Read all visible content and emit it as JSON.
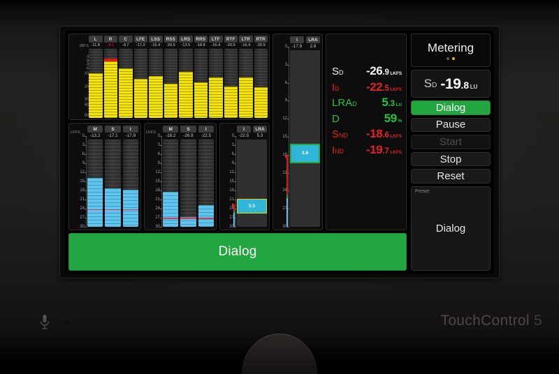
{
  "device": {
    "brand_name": "TouchControl",
    "brand_number": "5",
    "mic_icon": "microphone-icon"
  },
  "ppm": {
    "unit_label": "dBFS",
    "scale_ticks": [
      "3",
      "0",
      "3",
      "6",
      "10",
      "20",
      "30",
      "40",
      "60"
    ],
    "channels": [
      {
        "tag": "L",
        "value": "-11.8",
        "over": false,
        "level_pct": 64,
        "peak": false
      },
      {
        "tag": "R",
        "value": "-4.1",
        "over": true,
        "level_pct": 82,
        "peak": true
      },
      {
        "tag": "C",
        "value": "-9.7",
        "over": false,
        "level_pct": 72,
        "peak": false
      },
      {
        "tag": "LFE",
        "value": "-17.2",
        "over": false,
        "level_pct": 56,
        "peak": false
      },
      {
        "tag": "LSS",
        "value": "-15.4",
        "over": false,
        "level_pct": 60,
        "peak": false
      },
      {
        "tag": "RSS",
        "value": "-20.5",
        "over": false,
        "level_pct": 49,
        "peak": false
      },
      {
        "tag": "LRS",
        "value": "-13.5",
        "over": false,
        "level_pct": 66,
        "peak": false
      },
      {
        "tag": "RRS",
        "value": "-18.8",
        "over": false,
        "level_pct": 51,
        "peak": false
      },
      {
        "tag": "LTF",
        "value": "-16.4",
        "over": false,
        "level_pct": 58,
        "peak": false
      },
      {
        "tag": "RTF",
        "value": "-20.9",
        "over": false,
        "level_pct": 45,
        "peak": false
      },
      {
        "tag": "LTR",
        "value": "-16.4",
        "over": false,
        "level_pct": 58,
        "peak": false
      },
      {
        "tag": "RTR",
        "value": "-20.9",
        "over": false,
        "level_pct": 44,
        "peak": false
      }
    ]
  },
  "loudness_group_a": {
    "unit_label": "LKFS",
    "scale_ticks": [
      "0",
      "3",
      "6",
      "9",
      "12",
      "15",
      "18",
      "21",
      "24",
      "27",
      "30"
    ],
    "target_tick": "24",
    "meters": [
      {
        "tag": "M",
        "value": "-13.2",
        "level_pct": 56
      },
      {
        "tag": "S",
        "value": "-17.1",
        "level_pct": 44
      },
      {
        "tag": "I",
        "value": "-17.9",
        "level_pct": 42
      }
    ]
  },
  "loudness_group_b": {
    "unit_label": "LKFS",
    "scale_ticks": [
      "0",
      "3",
      "6",
      "9",
      "12",
      "15",
      "18",
      "21",
      "24",
      "27",
      "30"
    ],
    "target_tick": "27",
    "meters": [
      {
        "tag": "M",
        "value": "-18.2",
        "level_pct": 40
      },
      {
        "tag": "S",
        "value": "-26.9",
        "level_pct": 11
      },
      {
        "tag": "I",
        "value": "-22.5",
        "level_pct": 25
      }
    ]
  },
  "loudness_group_c": {
    "integrated_tag": "I",
    "integrated_value": "-22.5",
    "lra_tag": "LRA",
    "lra_value": "5.3",
    "scale_ticks": [
      "0",
      "3",
      "6",
      "9",
      "12",
      "15",
      "18",
      "21",
      "24",
      "27",
      "30"
    ],
    "lra_box_label": "5.3",
    "lra_box_top_pct": 68,
    "lra_box_height_pct": 17,
    "marker_pct": 75
  },
  "center_meter": {
    "integrated_tag": "I",
    "integrated_value": "-17.9",
    "lra_tag": "LRA",
    "lra_value": "2.8",
    "scale_ticks": [
      "0",
      "3",
      "6",
      "9",
      "12",
      "15",
      "18",
      "21",
      "24",
      "27",
      "30"
    ],
    "lra_box_label": "2.8",
    "lra_box_top_pct": 53,
    "lra_box_height_pct": 11,
    "marker_pct": 60
  },
  "readouts": [
    {
      "label": "S",
      "sub": "D",
      "int": "-26",
      "frac": ".9",
      "unit": "LKFS",
      "color": "c-white"
    },
    {
      "label": "I",
      "sub": "D",
      "int": "-22",
      "frac": ".5",
      "unit": "LKFS",
      "color": "c-red"
    },
    {
      "label": "LRA",
      "sub": "D",
      "int": "5",
      "frac": ".3",
      "unit": "LU",
      "color": "c-green"
    },
    {
      "label": "D",
      "sub": "",
      "int": "59",
      "frac": "",
      "unit": "%",
      "color": "c-green"
    },
    {
      "label": "S",
      "sub": "ND",
      "int": "-18",
      "frac": ".6",
      "unit": "LKFS",
      "color": "c-red"
    },
    {
      "label": "I",
      "sub": "ND",
      "int": "-19",
      "frac": ".7",
      "unit": "LKFS",
      "color": "c-red"
    }
  ],
  "dialog_bar": {
    "label": "Dialog"
  },
  "sidebar": {
    "menu_title": "Metering",
    "page_dots": [
      false,
      true
    ],
    "sd_readout": {
      "label": "S",
      "sub": "D",
      "int": "-19",
      "frac": ".8",
      "unit": "LU"
    },
    "buttons": [
      {
        "label": "Dialog",
        "state": "primary"
      },
      {
        "label": "Pause",
        "state": "normal"
      },
      {
        "label": "Start",
        "state": "disabled"
      },
      {
        "label": "Stop",
        "state": "normal"
      },
      {
        "label": "Reset",
        "state": "normal"
      }
    ],
    "preset": {
      "caption": "Preset",
      "value": "Dialog"
    }
  },
  "colors": {
    "ppm_fill": "#f5e400",
    "ppm_peak": "#e01b1b",
    "loudness_fill": "#5ec5ef",
    "target_line": "#d0405a",
    "accent_green": "#22a63f",
    "alert_red": "#e22121"
  }
}
